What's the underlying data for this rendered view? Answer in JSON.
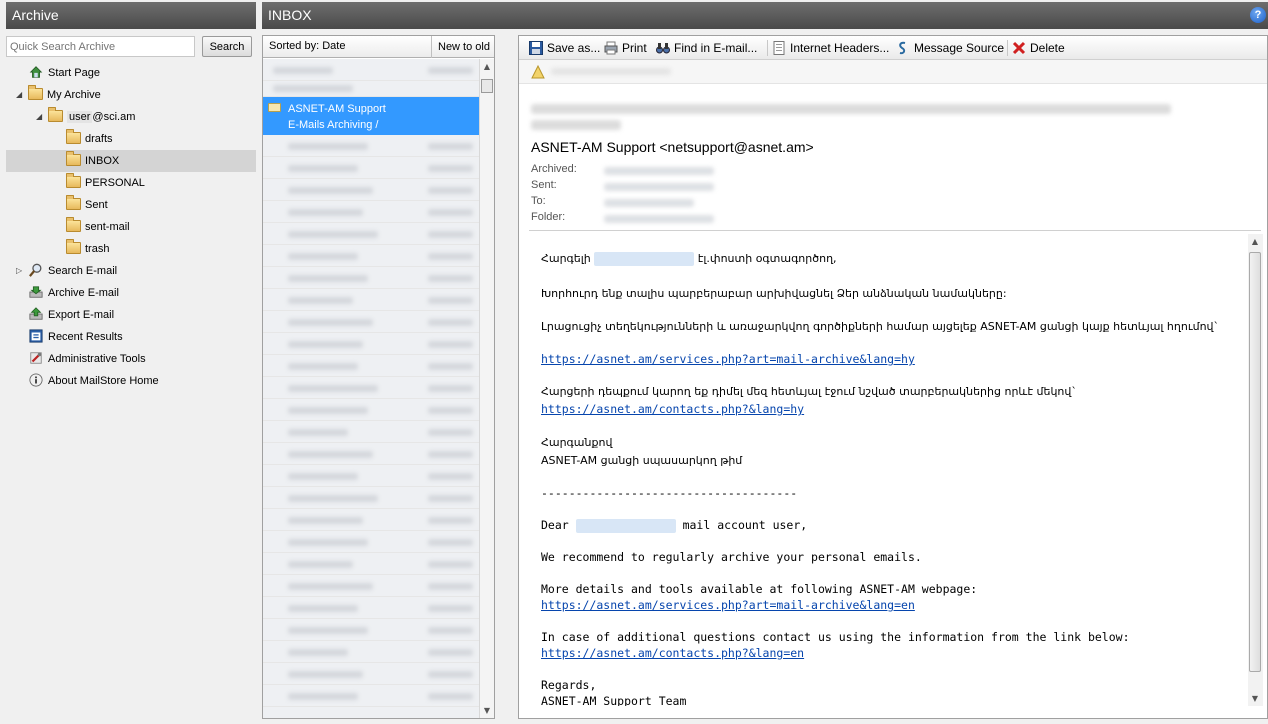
{
  "left_panel": {
    "title": "Archive",
    "search_placeholder": "Quick Search Archive",
    "search_button": "Search",
    "tree": {
      "start_page": "Start Page",
      "my_archive": "My Archive",
      "user_prefix": "user",
      "user_domain": "@sci.am",
      "folders": [
        "drafts",
        "INBOX",
        "PERSONAL",
        "Sent",
        "sent-mail",
        "trash"
      ],
      "selected_folder": "INBOX",
      "search_email": "Search E-mail",
      "archive_email": "Archive E-mail",
      "export_email": "Export E-mail",
      "recent_results": "Recent Results",
      "admin_tools": "Administrative Tools",
      "about": "About MailStore Home"
    }
  },
  "inbox_panel": {
    "title": "INBOX",
    "help_icon": "?"
  },
  "message_list": {
    "sort_label": "Sorted by: Date",
    "sort_order": "New to old",
    "selected": {
      "sender": "ASNET-AM Support",
      "subject": "E-Mails Archiving /"
    }
  },
  "toolbar": {
    "save": "Save as...",
    "print": "Print",
    "find": "Find in E-mail...",
    "headers": "Internet Headers...",
    "source": "Message Source",
    "delete": "Delete"
  },
  "email": {
    "sender": "ASNET-AM Support <netsupport@asnet.am>",
    "labels": {
      "archived": "Archived:",
      "sent": "Sent:",
      "to": "To:",
      "folder": "Folder:"
    },
    "body": {
      "hy_greeting_a": "Հարգելի",
      "hy_greeting_b": "էլ.փոստի օգտագործող,",
      "hy_line1": "Խորհուրդ ենք տալիս պարբերաբար արխիվացնել Ձեր անձնական նամակները:",
      "hy_line2": "Լրացուցիչ տեղեկությունների և առաջարկվող գործիքների համար այցելեք ASNET-AM ցանցի կայք հետևյալ հղումով`",
      "hy_link1": "https://asnet.am/services.php?art=mail-archive&lang=hy",
      "hy_line3": "Հարցերի դեպքում կարող եք դիմել մեզ հետևյալ էջում նշված տարբերակներից որևէ մեկով`",
      "hy_link2": "https://asnet.am/contacts.php?&lang=hy",
      "hy_regards": "Հարգանքով",
      "hy_team": "ASNET-AM ցանցի սպասարկող թիմ",
      "divider": "-------------------------------------",
      "en_dear_a": "Dear",
      "en_dear_b": "mail account user,",
      "en_line1": "We recommend to regularly archive your personal emails.",
      "en_line2": "More details and tools available at following ASNET-AM webpage:",
      "en_link1": "https://asnet.am/services.php?art=mail-archive&lang=en",
      "en_line3": "In case of additional questions contact us using the information from the link below:",
      "en_link2": "https://asnet.am/contacts.php?&lang=en",
      "en_regards": "Regards,",
      "en_team": "ASNET-AM Support Team"
    }
  }
}
